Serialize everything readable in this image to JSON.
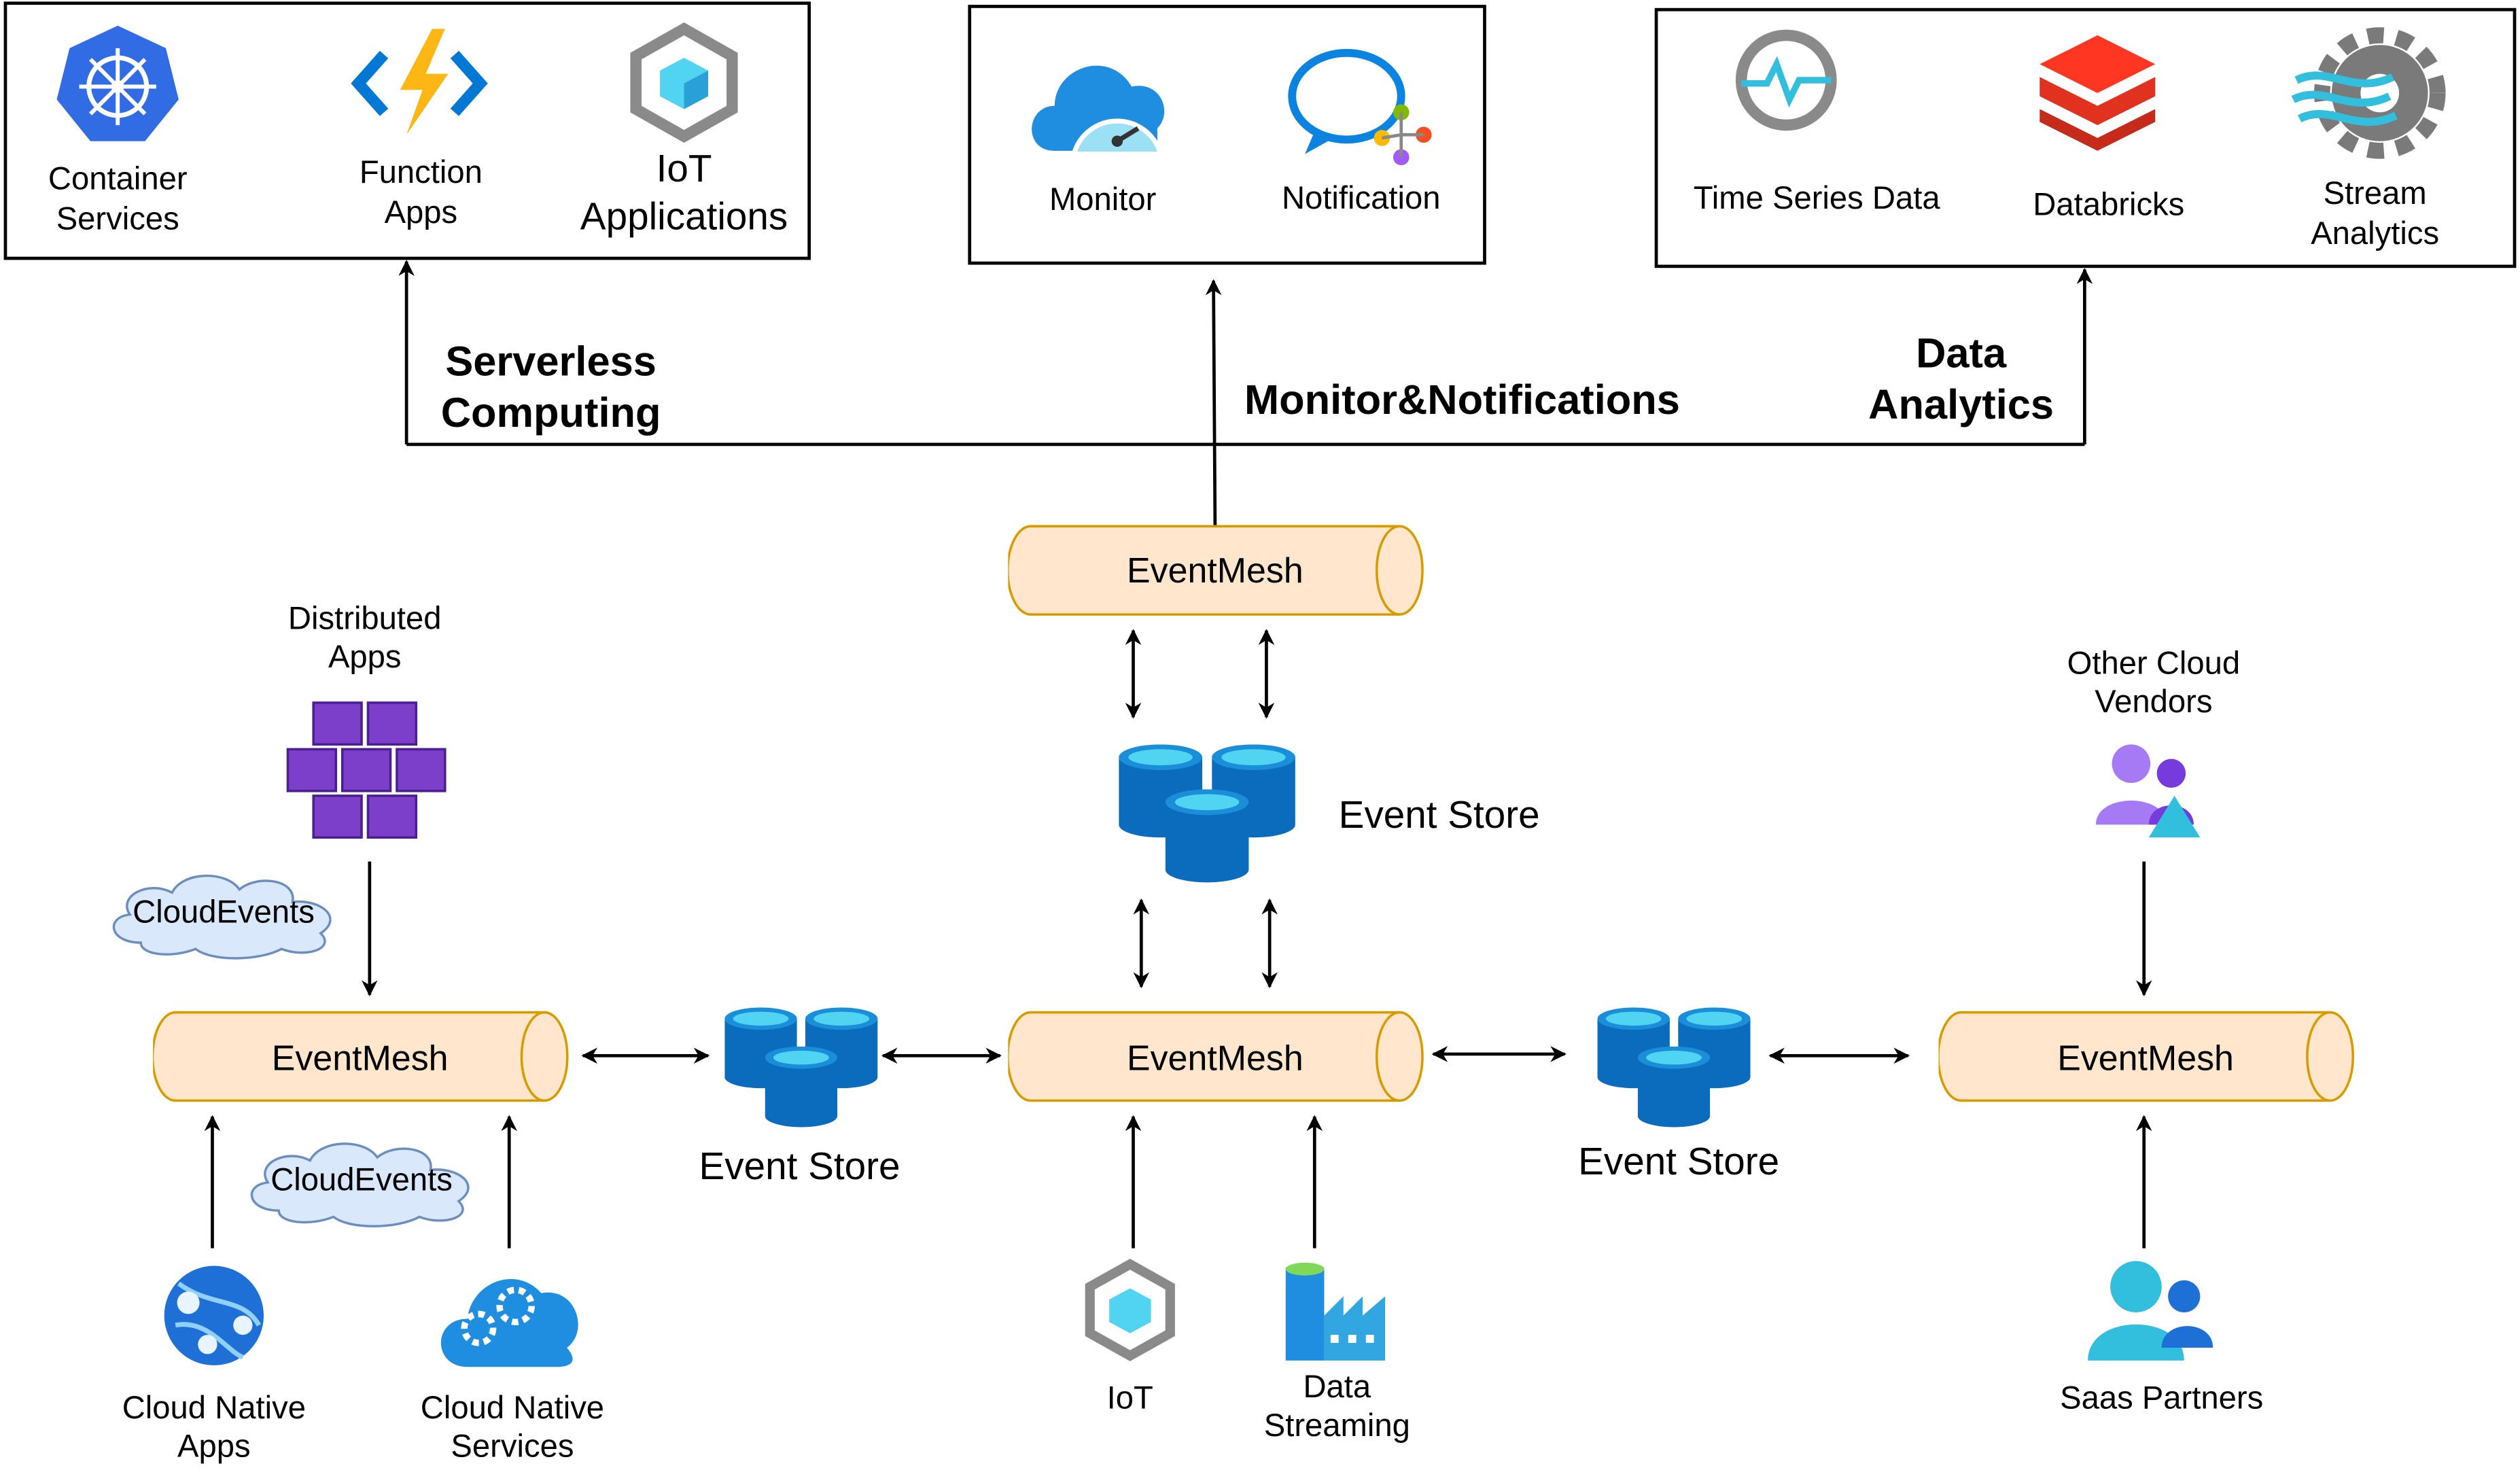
{
  "top_groups": {
    "compute": {
      "container": [
        "Container",
        "Services"
      ],
      "function": [
        "Function",
        "Apps"
      ],
      "iot": [
        "IoT",
        "Applications"
      ]
    },
    "monitor": {
      "monitor": "Monitor",
      "notification": "Notification"
    },
    "analytics": {
      "timeseries": "Time Series Data",
      "databricks": "Databricks",
      "stream": [
        "Stream",
        "Analytics"
      ]
    }
  },
  "connector_labels": {
    "serverless": [
      "Serverless",
      "Computing"
    ],
    "monitor": "Monitor&Notifications",
    "analytics": [
      "Data",
      "Analytics"
    ]
  },
  "event_mesh": {
    "top": "EventMesh",
    "left": "EventMesh",
    "center": "EventMesh",
    "right": "EventMesh"
  },
  "event_store": {
    "top": "Event Store",
    "left": "Event Store",
    "right": "Event Store"
  },
  "cloud_events": [
    "CloudEvents",
    "CloudEvents"
  ],
  "sources": {
    "distributed_apps": [
      "Distributed",
      "Apps"
    ],
    "other_cloud": [
      "Other Cloud",
      "Vendors"
    ],
    "cloud_native_apps": [
      "Cloud Native",
      "Apps"
    ],
    "cloud_native_services": [
      "Cloud Native",
      "Services"
    ],
    "iot": "IoT",
    "data_streaming": [
      "Data",
      "Streaming"
    ],
    "saas": "Saas Partners"
  },
  "colors": {
    "mesh_fill": "#ffe6cc",
    "mesh_stroke": "#d79b00",
    "store_blue": "#0b6cbd",
    "store_top": "#50d4f2",
    "cloud_fill": "#dae8fc",
    "cloud_stroke": "#6c8ebf"
  }
}
